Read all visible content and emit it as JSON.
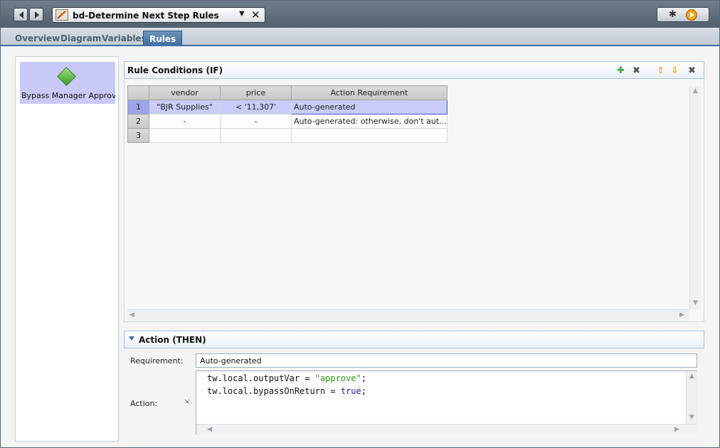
{
  "window": {
    "tab_title": "bd-Determine Next Step Rules",
    "icons": {
      "back": "back-arrow-icon",
      "forward": "forward-arrow-icon",
      "dropdown": "dropdown-triangle-icon",
      "close": "close-icon",
      "debug": "bug-icon",
      "run": "play-icon"
    }
  },
  "tabs": [
    {
      "label": "Overview",
      "active": false
    },
    {
      "label": "Diagram",
      "active": false
    },
    {
      "label": "Variables",
      "active": false
    },
    {
      "label": "Rules",
      "active": true
    }
  ],
  "sidebar": {
    "item_label": "Bypass Manager Approv...",
    "item_icon": "green-diamond-icon"
  },
  "rule_conditions": {
    "title": "Rule Conditions (IF)",
    "toolbar_icons": [
      "add-icon",
      "delete-icon",
      "move-up-icon",
      "move-down-icon",
      "remove-icon"
    ],
    "columns": [
      "vendor",
      "price",
      "Action Requirement"
    ],
    "rows": [
      {
        "num": "1",
        "vendor": "\"BJR Supplies\"",
        "price": "< '11,307'",
        "action": "Auto-generated",
        "selected": true
      },
      {
        "num": "2",
        "vendor": "-",
        "price": "-",
        "action": "Auto-generated: otherwise, don't aut...",
        "selected": false
      },
      {
        "num": "3",
        "vendor": "",
        "price": "",
        "action": "",
        "selected": false
      }
    ]
  },
  "action": {
    "title": "Action (THEN)",
    "requirement_label": "Requirement:",
    "requirement_value": "Auto-generated",
    "action_label": "Action:",
    "code_lines": [
      {
        "pre": "tw.local.outputVar = ",
        "val": "\"approve\"",
        "post": ";"
      },
      {
        "pre": "tw.local.bypassOnReturn = ",
        "val": "true",
        "post": ";"
      }
    ]
  },
  "colors": {
    "accent": "#3f6f9f",
    "selected_row": "#c8ccf6",
    "string": "#2a9a1a",
    "keyword": "#1b1b9e"
  }
}
